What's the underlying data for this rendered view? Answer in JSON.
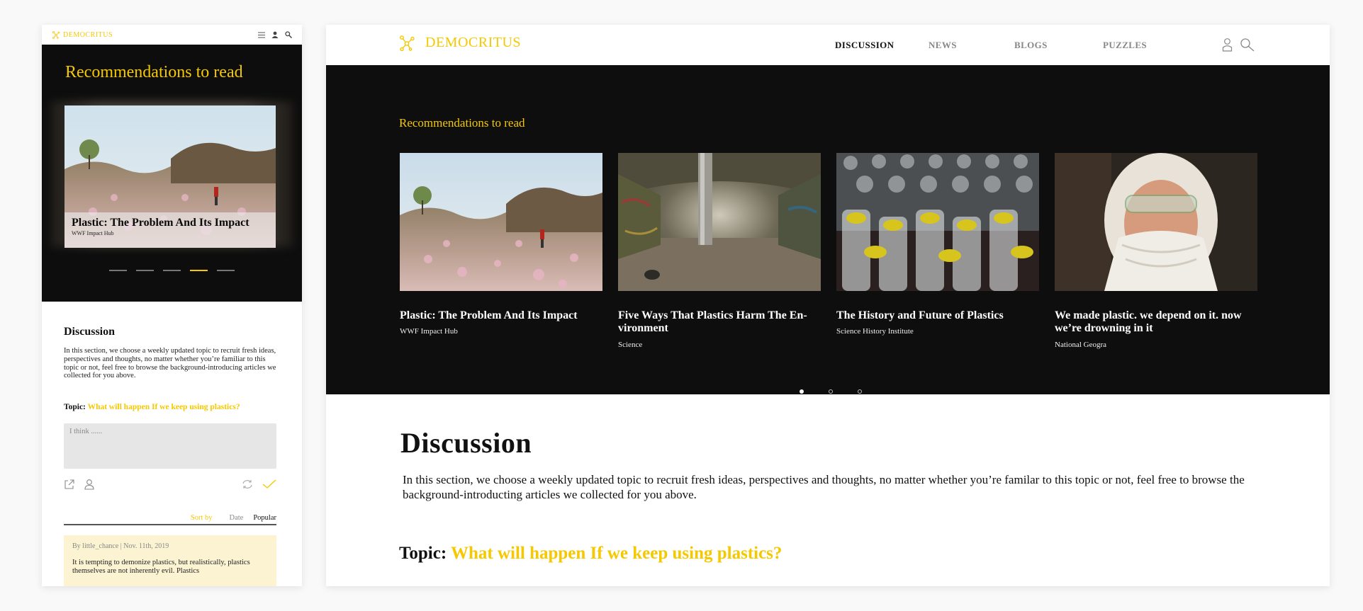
{
  "brand": {
    "name": "DEMOCRITUS",
    "accent": "#f5c800"
  },
  "nav": [
    {
      "label": "DISCUSSION",
      "active": true
    },
    {
      "label": "NEWS",
      "active": false
    },
    {
      "label": "BLOGS",
      "active": false
    },
    {
      "label": "PUZZLES",
      "active": false
    }
  ],
  "icons": {
    "menu": "hamburger-icon",
    "user": "user-icon",
    "search": "search-icon"
  },
  "recommendations": {
    "title": "Recommendations to read",
    "cards": [
      {
        "title": "Plastic: The Problem And Its Impact",
        "source": "WWF Impact Hub"
      },
      {
        "title": "Five Ways That Plastics Harm The En-vironment",
        "source": "Science"
      },
      {
        "title": "The History and Future of Plastics",
        "source": "Science History Institute"
      },
      {
        "title": "We made plastic. we depend on it. now we’re drowning in it",
        "source": "National Geogra"
      }
    ]
  },
  "discussion": {
    "heading": "Discussion",
    "desktop_intro": "In this section, we choose a weekly updated topic to recruit fresh ideas, perspectives and thoughts, no matter whether you’re familar to this topic or not, feel free to browse the background-introducting articles we collected for you above.",
    "mobile_intro": "In this section, we choose a weekly updated topic to recruit fresh ideas, perspectives and thoughts, no matter whether you’re familiar to this topic or not, feel free to browse the background-introducing articles we collected for you above.",
    "topic_label": "Topic:",
    "topic_question": "What will happen If we keep using plastics?",
    "input_placeholder": "I think ......",
    "sort": {
      "label": "Sort by",
      "date": "Date",
      "popular": "Popular"
    },
    "comment": {
      "meta": "By little_chance | Nov. 11th, 2019",
      "text": "It is tempting to demonize plastics, but realistically, plastics themselves are not inherently evil. Plastics"
    }
  },
  "carousel": {
    "mobile_active_index": 3,
    "mobile_count": 5,
    "desktop_active_index": 0,
    "desktop_count": 3
  }
}
